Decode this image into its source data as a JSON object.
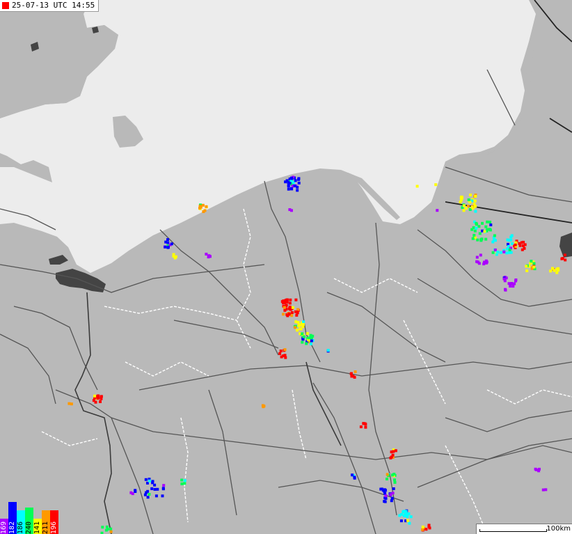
{
  "timestamp": "25-07-13 UTC 14:55",
  "scale_label": "100km",
  "legend": [
    {
      "label": "169",
      "color": "#aa00ff",
      "text_color": "#ffffff",
      "height": 22
    },
    {
      "label": "182",
      "color": "#0000ff",
      "text_color": "#ffffff",
      "height": 46
    },
    {
      "label": "186",
      "color": "#00ffff",
      "text_color": "#000000",
      "height": 34
    },
    {
      "label": "240",
      "color": "#00ff55",
      "text_color": "#000000",
      "height": 38
    },
    {
      "label": "141",
      "color": "#ffff00",
      "text_color": "#000000",
      "height": 22
    },
    {
      "label": "211",
      "color": "#ff9900",
      "text_color": "#000000",
      "height": 34
    },
    {
      "label": "196",
      "color": "#ff0000",
      "text_color": "#ffffff",
      "height": 34
    }
  ],
  "strike_colors": [
    "#aa00ff",
    "#0000ff",
    "#00ffff",
    "#00ff55",
    "#ffff00",
    "#ff9900",
    "#ff0000"
  ],
  "map_colors": {
    "land": "#b9b9b9",
    "sea": "#ececec",
    "lake": "#444444",
    "road": "#555555",
    "border": "#ffffff"
  }
}
